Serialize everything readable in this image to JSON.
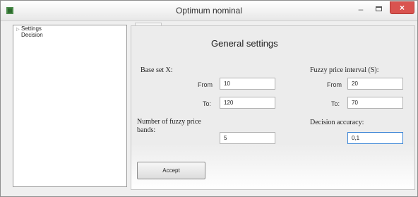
{
  "window": {
    "title": "Optimum nominal",
    "minimize_glyph": "–",
    "close_glyph": "×"
  },
  "sidebar": {
    "items": [
      {
        "label": "Settings"
      },
      {
        "label": "Decision"
      }
    ]
  },
  "form": {
    "heading": "General settings",
    "base_set": {
      "label": "Base set X:",
      "from_label": "From",
      "from_value": "10",
      "to_label": "To:",
      "to_value": "120"
    },
    "fuzzy_interval": {
      "label": "Fuzzy price interval (S):",
      "from_label": "From",
      "from_value": "20",
      "to_label": "To:",
      "to_value": "70"
    },
    "bands": {
      "label_line1": "Number of fuzzy price",
      "label_line2": "bands:",
      "value": "5"
    },
    "accuracy": {
      "label": "Decision accuracy:",
      "value": "0,1"
    },
    "accept_label": "Accept"
  }
}
